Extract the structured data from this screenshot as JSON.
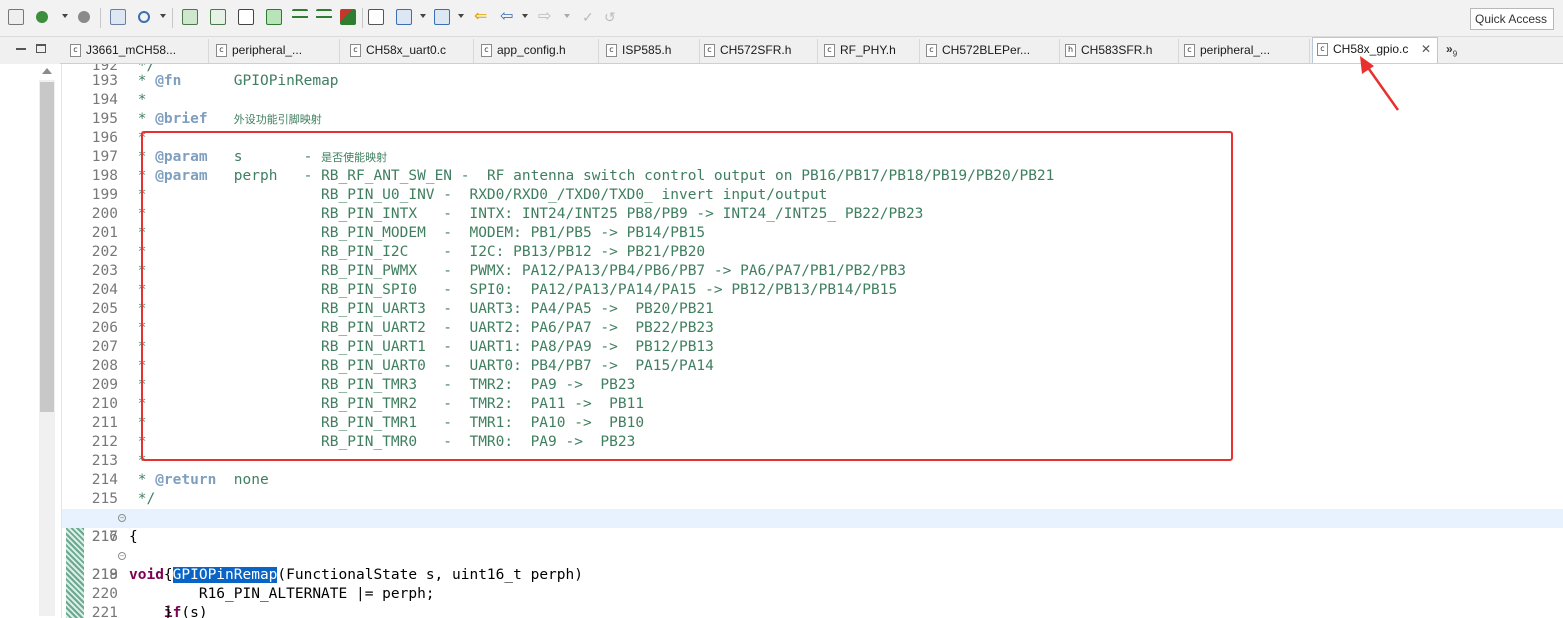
{
  "toolbar": {
    "quick_access": "Quick Access",
    "icons": [
      "new-icon",
      "build-icon",
      "debug-icon",
      "search-icon",
      "save-icon",
      "console-icon",
      "run-icon",
      "step-icon",
      "edit-icon",
      "back-icon",
      "forward-icon"
    ]
  },
  "tabs": [
    {
      "label": "J3661_mCH58...",
      "icon": "c"
    },
    {
      "label": "peripheral_...",
      "icon": "c"
    },
    {
      "label": "CH58x_uart0.c",
      "icon": "c"
    },
    {
      "label": "app_config.h",
      "icon": "c"
    },
    {
      "label": "ISP585.h",
      "icon": "c"
    },
    {
      "label": "CH572SFR.h",
      "icon": "c"
    },
    {
      "label": "RF_PHY.h",
      "icon": "c"
    },
    {
      "label": "CH572BLEPer...",
      "icon": "c"
    },
    {
      "label": "CH583SFR.h",
      "icon": "h"
    },
    {
      "label": "peripheral_...",
      "icon": "c"
    },
    {
      "label": "CH58x_gpio.c",
      "icon": "c",
      "active": true
    }
  ],
  "overflow": {
    "symbol": "»",
    "count": "9"
  },
  "editor": {
    "lines": [
      {
        "n": "192",
        "text": " */"
      },
      {
        "n": "193",
        "text": " * @fn      GPIOPinRemap"
      },
      {
        "n": "194",
        "text": " *"
      },
      {
        "n": "195",
        "text": " * @brief   外设功能引脚映射"
      },
      {
        "n": "196",
        "text": " *"
      },
      {
        "n": "197",
        "text": " * @param   s       - 是否使能映射"
      },
      {
        "n": "198",
        "text": " * @param   perph   - RB_RF_ANT_SW_EN -  RF antenna switch control output on PB16/PB17/PB18/PB19/PB20/PB21"
      },
      {
        "n": "199",
        "text": " *                    RB_PIN_U0_INV -  RXD0/RXD0_/TXD0/TXD0_ invert input/output"
      },
      {
        "n": "200",
        "text": " *                    RB_PIN_INTX   -  INTX: INT24/INT25 PB8/PB9 -> INT24_/INT25_ PB22/PB23"
      },
      {
        "n": "201",
        "text": " *                    RB_PIN_MODEM  -  MODEM: PB1/PB5 -> PB14/PB15"
      },
      {
        "n": "202",
        "text": " *                    RB_PIN_I2C    -  I2C: PB13/PB12 -> PB21/PB20"
      },
      {
        "n": "203",
        "text": " *                    RB_PIN_PWMX   -  PWMX: PA12/PA13/PB4/PB6/PB7 -> PA6/PA7/PB1/PB2/PB3"
      },
      {
        "n": "204",
        "text": " *                    RB_PIN_SPI0   -  SPI0:  PA12/PA13/PA14/PA15 -> PB12/PB13/PB14/PB15"
      },
      {
        "n": "205",
        "text": " *                    RB_PIN_UART3  -  UART3: PA4/PA5 ->  PB20/PB21"
      },
      {
        "n": "206",
        "text": " *                    RB_PIN_UART2  -  UART2: PA6/PA7 ->  PB22/PB23"
      },
      {
        "n": "207",
        "text": " *                    RB_PIN_UART1  -  UART1: PA8/PA9 ->  PB12/PB13"
      },
      {
        "n": "208",
        "text": " *                    RB_PIN_UART0  -  UART0: PB4/PB7 ->  PA15/PA14"
      },
      {
        "n": "209",
        "text": " *                    RB_PIN_TMR3   -  TMR2:  PA9 ->  PB23"
      },
      {
        "n": "210",
        "text": " *                    RB_PIN_TMR2   -  TMR2:  PA11 ->  PB11"
      },
      {
        "n": "211",
        "text": " *                    RB_PIN_TMR1   -  TMR1:  PA10 ->  PB10"
      },
      {
        "n": "212",
        "text": " *                    RB_PIN_TMR0   -  TMR0:  PA9 ->  PB23"
      },
      {
        "n": "213",
        "text": " *"
      },
      {
        "n": "214",
        "text": " * @return  none"
      },
      {
        "n": "215",
        "text": " */"
      },
      {
        "n": "216",
        "text": "void GPIOPinRemap(FunctionalState s, uint16_t perph)",
        "fold": true,
        "current": true
      },
      {
        "n": "217",
        "text": "{"
      },
      {
        "n": "218",
        "text": "    if(s)",
        "fold": true
      },
      {
        "n": "219",
        "text": "    {"
      },
      {
        "n": "220",
        "text": "        R16_PIN_ALTERNATE |= perph;"
      },
      {
        "n": "221",
        "text": "    }"
      }
    ]
  },
  "annotation_color": "#e8312f"
}
